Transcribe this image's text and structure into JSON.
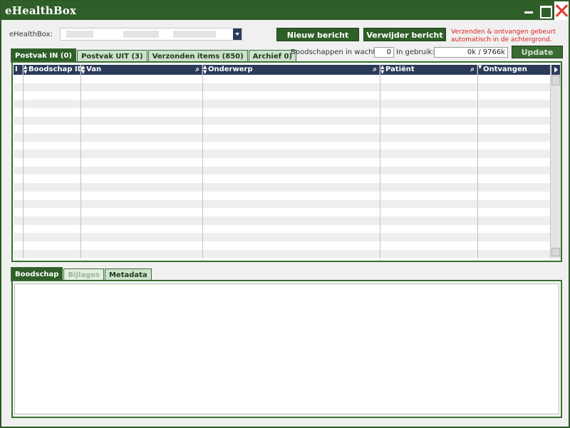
{
  "window": {
    "title": "eHealthBox"
  },
  "account": {
    "label": "eHealthBox:",
    "selected": ""
  },
  "toolbar": {
    "new_message": "Nieuw bericht",
    "delete_message": "Verwijder bericht",
    "notice_line1": "Verzenden & ontvangen gebeurt",
    "notice_line2": "automatisch in de achtergrond."
  },
  "mailbox_tabs": [
    {
      "label": "Postvak IN (0)",
      "active": true
    },
    {
      "label": "Postvak UIT (3)",
      "active": false
    },
    {
      "label": "Verzonden items (850)",
      "active": false
    },
    {
      "label": "Archief 0)",
      "active": false
    }
  ],
  "status": {
    "waiting_label": "Boodschappen in wacht:",
    "waiting_value": "0",
    "usage_label": "In gebruik:",
    "usage_value": "0k / 9766k",
    "update_button": "Update"
  },
  "table": {
    "columns": [
      {
        "key": "i",
        "label": "I"
      },
      {
        "key": "id",
        "label": "Boodschap ID"
      },
      {
        "key": "from",
        "label": "Van"
      },
      {
        "key": "subject",
        "label": "Onderwerp"
      },
      {
        "key": "patient",
        "label": "Patiënt"
      },
      {
        "key": "received",
        "label": "Ontvangen"
      }
    ],
    "rows": []
  },
  "detail_tabs": [
    {
      "label": "Boodschap",
      "active": true,
      "enabled": true
    },
    {
      "label": "Bijlages",
      "active": false,
      "enabled": false
    },
    {
      "label": "Metadata",
      "active": false,
      "enabled": true
    }
  ],
  "colors": {
    "titlebar": "#2f5f28",
    "header": "#2c3a5a",
    "notice": "#e02020",
    "close": "#e6352f"
  },
  "icons": {
    "minimize": "minimize-icon",
    "maximize": "maximize-icon",
    "close": "close-icon",
    "search": "search-icon",
    "sort": "sort-icon",
    "dropdown": "chevron-down-icon"
  }
}
